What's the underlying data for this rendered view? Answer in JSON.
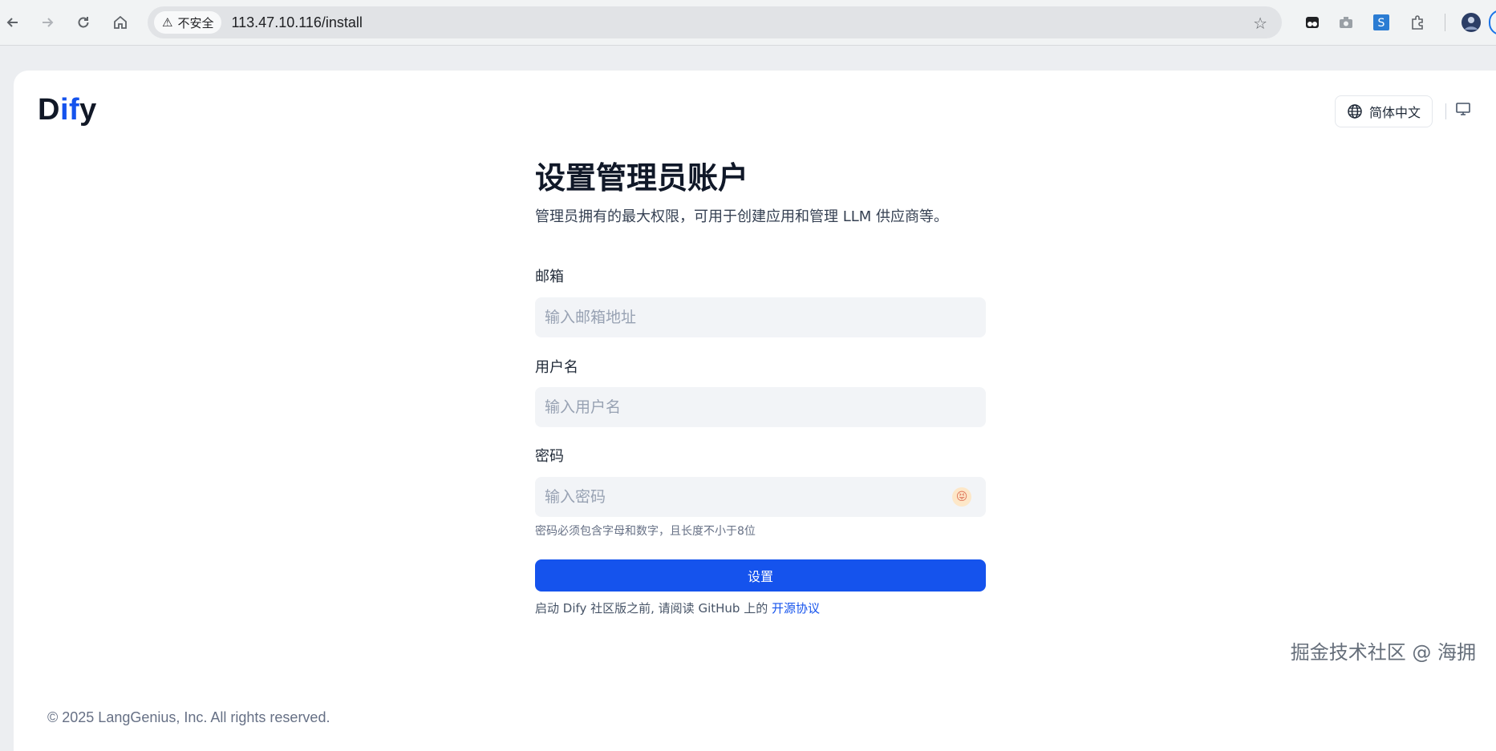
{
  "browser": {
    "security_label": "不安全",
    "url": "113.47.10.116/install"
  },
  "header": {
    "logo_prefix": "D",
    "logo_mid": "if",
    "logo_suffix": "y",
    "language_label": "简体中文"
  },
  "form": {
    "title": "设置管理员账户",
    "subtitle": "管理员拥有的最大权限，可用于创建应用和管理 LLM 供应商等。",
    "email_label": "邮箱",
    "email_placeholder": "输入邮箱地址",
    "username_label": "用户名",
    "username_placeholder": "输入用户名",
    "password_label": "密码",
    "password_placeholder": "输入密码",
    "password_hint": "密码必须包含字母和数字，且长度不小于8位",
    "submit_label": "设置",
    "notice_prefix": "启动 Dify 社区版之前, 请阅读 GitHub 上的",
    "notice_link": "开源协议"
  },
  "footer": {
    "copyright": "© 2025 LangGenius, Inc. All rights reserved."
  },
  "watermark": "掘金技术社区 @ 海拥",
  "colors": {
    "accent": "#1553ed",
    "input_bg": "#f2f4f7"
  }
}
